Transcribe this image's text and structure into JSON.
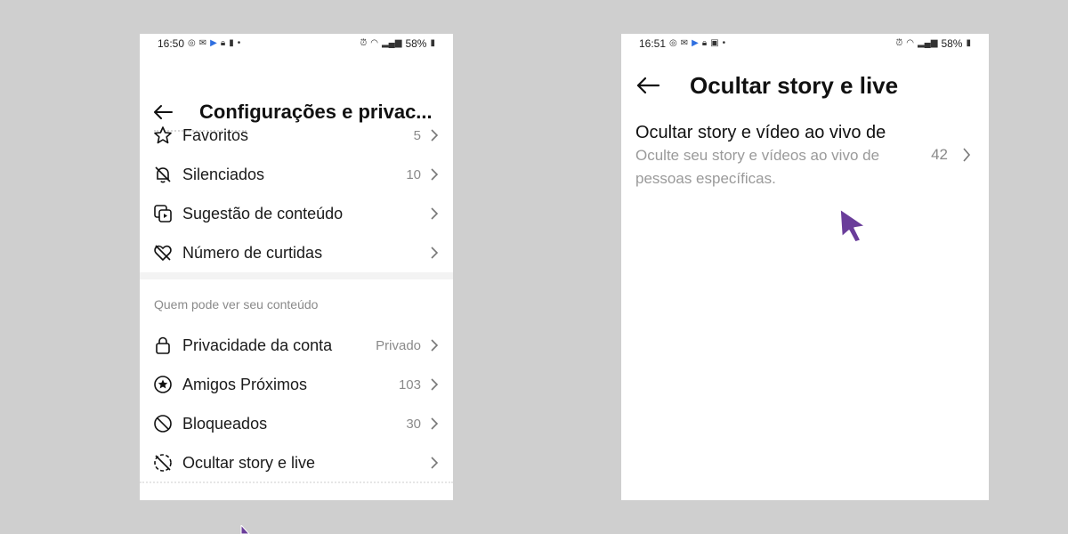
{
  "left_screen": {
    "status_bar": {
      "time": "16:50",
      "battery": "58%"
    },
    "title": "Configurações e privac...",
    "items": [
      {
        "icon": "star-icon",
        "label": "Favoritos",
        "value": "5"
      },
      {
        "icon": "bell-off-icon",
        "label": "Silenciados",
        "value": "10"
      },
      {
        "icon": "media-suggestion-icon",
        "label": "Sugestão de conteúdo",
        "value": ""
      },
      {
        "icon": "heart-off-icon",
        "label": "Número de curtidas",
        "value": ""
      }
    ],
    "section_header": "Quem pode ver seu conteúdo",
    "items2": [
      {
        "icon": "lock-icon",
        "label": "Privacidade da conta",
        "value": "Privado"
      },
      {
        "icon": "star-circle-icon",
        "label": "Amigos Próximos",
        "value": "103"
      },
      {
        "icon": "block-icon",
        "label": "Bloqueados",
        "value": "30"
      },
      {
        "icon": "story-off-icon",
        "label": "Ocultar story e live",
        "value": ""
      }
    ]
  },
  "right_screen": {
    "status_bar": {
      "time": "16:51",
      "battery": "58%"
    },
    "title": "Ocultar story e live",
    "row": {
      "title": "Ocultar story e vídeo ao vivo de",
      "description": "Oculte seu story e vídeos ao vivo de pessoas específicas.",
      "value": "42"
    }
  },
  "colors": {
    "cursor": "#6a3d9a",
    "background": "#cfcfcf",
    "secondary_text": "#8a8a8a"
  }
}
